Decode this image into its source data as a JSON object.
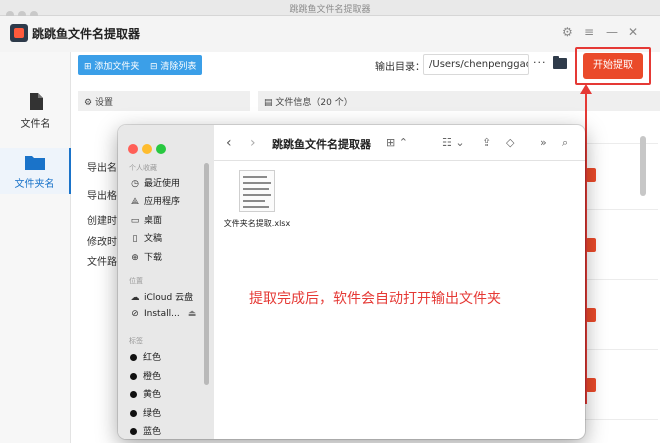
{
  "window": {
    "title": "跳跳鱼文件名提取器"
  },
  "app": {
    "title": "跳跳鱼文件名提取器"
  },
  "sidebar": {
    "items": [
      {
        "label": "文件名"
      },
      {
        "label": "文件夹名"
      }
    ]
  },
  "toolbar": {
    "add_folder_label": "添加文件夹",
    "clear_list_label": "清除列表",
    "output_dir_label": "输出目录：",
    "output_dir_value": "/Users/chenpenggao/D",
    "more_label": "···",
    "start_label": "开始提取"
  },
  "settings_panel": {
    "title": "设置",
    "rows": [
      "导出名",
      "导出格",
      "创建时",
      "修改时",
      "文件路"
    ]
  },
  "files_panel": {
    "title": "文件信息（20 个）"
  },
  "finder": {
    "title": "跳跳鱼文件名提取器",
    "favorites_header": "个人收藏",
    "favorites": [
      "最近使用",
      "应用程序",
      "桌面",
      "文稿",
      "下载"
    ],
    "locations_header": "位置",
    "locations": [
      "iCloud 云盘",
      "Install..."
    ],
    "tags_header": "标签",
    "tags": [
      {
        "label": "红色",
        "color": "#111111"
      },
      {
        "label": "橙色",
        "color": "#111111"
      },
      {
        "label": "黄色",
        "color": "#111111"
      },
      {
        "label": "绿色",
        "color": "#111111"
      },
      {
        "label": "蓝色",
        "color": "#111111"
      }
    ],
    "file": {
      "name": "文件夹名提取.xlsx"
    },
    "message": "提取完成后，软件会自动打开输出文件夹"
  },
  "colors": {
    "accent": "#3b9fe8",
    "start_button": "#ea4a2a",
    "annotation": "#e53935"
  }
}
